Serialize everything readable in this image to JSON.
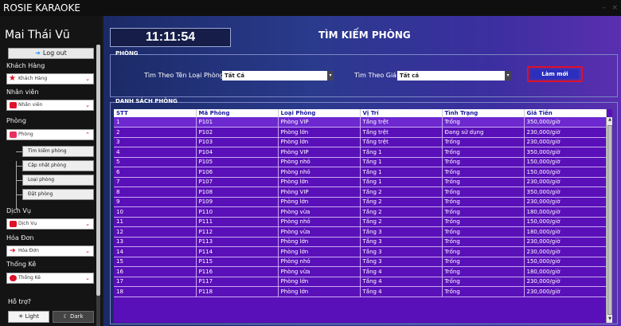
{
  "app": {
    "title": "ROSIE KARAOKE"
  },
  "sidebar": {
    "user_name": "Mai Thái Vũ",
    "logout_label": "Log out",
    "sections": [
      {
        "label": "Khách Hàng",
        "combo": "Khách Hàng"
      },
      {
        "label": "Nhân viên",
        "combo": "Nhân viên"
      },
      {
        "label": "Phòng",
        "combo": "Phòng"
      },
      {
        "label": "Dịch Vụ",
        "combo": "Dịch Vụ"
      },
      {
        "label": "Hóa Đơn",
        "combo": "Hóa Đơn"
      },
      {
        "label": "Thống Kê",
        "combo": "Thống Kê"
      }
    ],
    "room_subitems": [
      "Tìm kiếm phòng",
      "Cập nhật phòng",
      "Loại phòng",
      "Đặt phòng"
    ],
    "help_label": "Hỗ trợ?",
    "theme_light": "Light",
    "theme_dark": "Dark"
  },
  "header": {
    "clock": "11:11:54",
    "page_title": "TÌM KIẾM PHÒNG"
  },
  "filters": {
    "group_title": "PHÒNG",
    "room_type_label": "Tìm Theo Tên Loại Phòng:",
    "room_type_value": "Tất Cả",
    "price_label": "Tìm Theo Giá:",
    "price_value": "Tất cả",
    "refresh_label": "Làm mới"
  },
  "room_list": {
    "group_title": "DANH SÁCH PHÒNG",
    "columns": [
      "STT",
      "Mã Phòng",
      "Loại Phòng",
      "Vị Trí",
      "Tình Trạng",
      "Giá Tiền"
    ],
    "rows": [
      [
        "1",
        "P101",
        "Phòng VIP",
        "Tầng trệt",
        "Trống",
        "350,000/giờ"
      ],
      [
        "2",
        "P102",
        "Phòng lớn",
        "Tầng trệt",
        "Đang sử dụng",
        "230,000/giờ"
      ],
      [
        "3",
        "P103",
        "Phòng lớn",
        "Tầng trệt",
        "Trống",
        "230,000/giờ"
      ],
      [
        "4",
        "P104",
        "Phòng VIP",
        "Tầng 1",
        "Trống",
        "350,000/giờ"
      ],
      [
        "5",
        "P105",
        "Phòng nhỏ",
        "Tầng 1",
        "Trống",
        "150,000/giờ"
      ],
      [
        "6",
        "P106",
        "Phòng nhỏ",
        "Tầng 1",
        "Trống",
        "150,000/giờ"
      ],
      [
        "7",
        "P107",
        "Phòng lớn",
        "Tầng 1",
        "Trống",
        "230,000/giờ"
      ],
      [
        "8",
        "P108",
        "Phòng VIP",
        "Tầng 2",
        "Trống",
        "350,000/giờ"
      ],
      [
        "9",
        "P109",
        "Phòng lớn",
        "Tầng 2",
        "Trống",
        "230,000/giờ"
      ],
      [
        "10",
        "P110",
        "Phòng vừa",
        "Tầng 2",
        "Trống",
        "180,000/giờ"
      ],
      [
        "11",
        "P111",
        "Phòng nhỏ",
        "Tầng 2",
        "Trống",
        "150,000/giờ"
      ],
      [
        "12",
        "P112",
        "Phòng vừa",
        "Tầng 3",
        "Trống",
        "180,000/giờ"
      ],
      [
        "13",
        "P113",
        "Phòng lớn",
        "Tầng 3",
        "Trống",
        "230,000/giờ"
      ],
      [
        "14",
        "P114",
        "Phòng lớn",
        "Tầng 3",
        "Trống",
        "230,000/giờ"
      ],
      [
        "15",
        "P115",
        "Phòng nhỏ",
        "Tầng 3",
        "Trống",
        "150,000/giờ"
      ],
      [
        "16",
        "P116",
        "Phòng vừa",
        "Tầng 4",
        "Trống",
        "180,000/giờ"
      ],
      [
        "17",
        "P117",
        "Phòng lớn",
        "Tầng 4",
        "Trống",
        "230,000/giờ"
      ],
      [
        "18",
        "P118",
        "Phòng lớn",
        "Tầng 4",
        "Trống",
        "230,000/giờ"
      ]
    ]
  }
}
